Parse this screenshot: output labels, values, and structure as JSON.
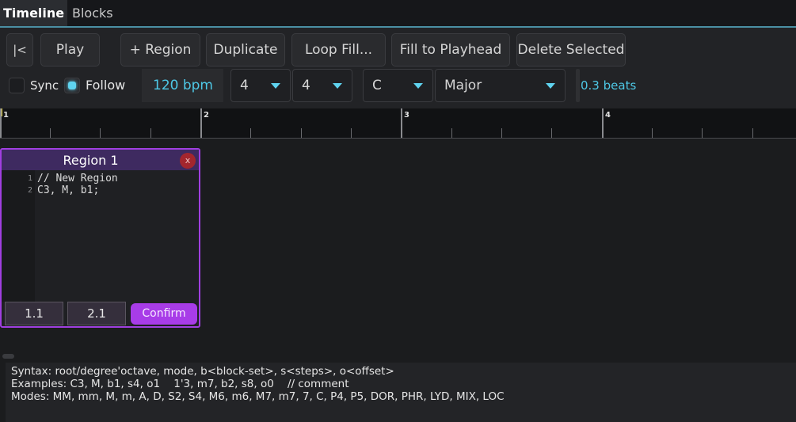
{
  "tabs": [
    {
      "label": "Timeline",
      "active": true
    },
    {
      "label": "Blocks",
      "active": false
    }
  ],
  "toolbar": {
    "go_start_label": "|<",
    "play_label": "Play",
    "add_region_label": "+ Region",
    "duplicate_label": "Duplicate",
    "loop_fill_label": "Loop Fill...",
    "fill_to_playhead_label": "Fill to Playhead",
    "delete_selected_label": "Delete Selected",
    "sync_label": "Sync",
    "sync_checked": false,
    "follow_label": "Follow",
    "follow_checked": true,
    "tempo": "120 bpm",
    "time_sig_numerator": "4",
    "time_sig_denominator": "4",
    "key_root": "C",
    "key_mode": "Major",
    "snap_value": "0.3 beats"
  },
  "ruler": {
    "bars": [
      "1",
      "2",
      "3",
      "4"
    ]
  },
  "region": {
    "title": "Region 1",
    "close_label": "x",
    "lines": [
      {
        "num": "1",
        "text": "// New Region"
      },
      {
        "num": "2",
        "text": "C3, M, b1;"
      }
    ],
    "start_pos": "1.1",
    "end_pos": "2.1",
    "confirm_label": "Confirm"
  },
  "help": {
    "syntax": "Syntax: root/degree'octave, mode, b<block-set>, s<steps>, o<offset>",
    "examples": "Examples: C3, M, b1, s4, o1    1'3, m7, b2, s8, o0    // comment",
    "modes": "Modes: MM, mm, M, m, A, D, S2, S4, M6, m6, M7, m7, 7, C, P4, P5, DOR, PHR, LYD, MIX, LOC"
  },
  "colors": {
    "accent_cyan": "#4ec8e6",
    "region_purple": "#a03fe0",
    "confirm_purple": "#a83ce8",
    "close_red": "#a3262e",
    "playhead_yellow": "#e8d43a"
  }
}
